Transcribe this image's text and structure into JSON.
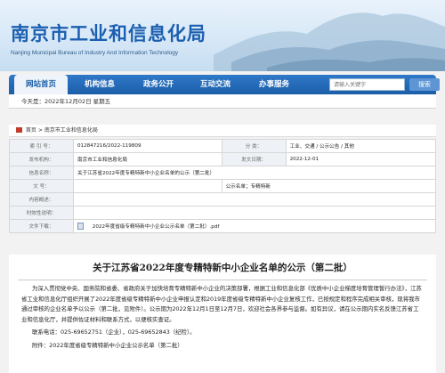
{
  "header": {
    "title": "南京市工业和信息化局",
    "subtitle": "Nanjing Municipal Bureau of Industry And Information Technology"
  },
  "nav": {
    "items": [
      {
        "label": "网站首页",
        "active": true
      },
      {
        "label": "机构信息",
        "active": false
      },
      {
        "label": "政务公开",
        "active": false
      },
      {
        "label": "互动交流",
        "active": false
      },
      {
        "label": "办事服务",
        "active": false
      }
    ],
    "search_placeholder": "请输入关键字",
    "search_button": "搜索"
  },
  "date_line": "今天是：2022年12月02日 星期五",
  "breadcrumb": {
    "home": "首页",
    "sep": ">",
    "current": "南京市工业和信息化局"
  },
  "meta": {
    "index_label": "索 引 号：",
    "index_value": "012847216/2022-119809",
    "category_label": "分 类：",
    "category_value": "工业、交通 / 公示公告 / 其他",
    "publisher_label": "发布机构：",
    "publisher_value": "南京市工业和信息化局",
    "date_label": "发文日期：",
    "date_value": "2022-12-01",
    "name_label": "信息名称：",
    "name_value": "关于江苏省2022年度专精特新中小企业名单的公示（第二批）",
    "docno_label": "文 号：",
    "docno_value": "",
    "keywords_label": "公示名单；专精特新",
    "summary_label": "内容概述：",
    "summary_value": "",
    "validity_label": "时效性说明：",
    "validity_value": "",
    "attach_label": "文件下载：",
    "attach_value": "2022年度省级专精特新中小企业公示名单（第二批）.pdf"
  },
  "article": {
    "title": "关于江苏省2022年度专精特新中小企业名单的公示（第二批）",
    "body": "为深入贯彻党中央、国务院和省委、省政府关于加快培育专精特新中小企业的决策部署，根据工业和信息化部《优质中小企业梯度培育管理暂行办法》，江苏省工业和信息化厅组织开展了2022年度省级专精特新中小企业申报认定和2019年度省级专精特新中小企业复核工作，已按规定和程序完成相关审核，现将我市通过审核的企业名单予以公示（第二批，见附件）。公示期为2022年12月1日至12月7日，欢迎社会各界参与监督。如有异议，请在公示期内实名反馈江苏省工业和信息化厅，并提供佐证材料和联系方式，以便核实查证。",
    "contact": "联系电话：025-69652751（企业），025-69652843（纪检）。",
    "attachment": "附件：2022年度省级专精特新中小企业公示名单（第二批）"
  }
}
